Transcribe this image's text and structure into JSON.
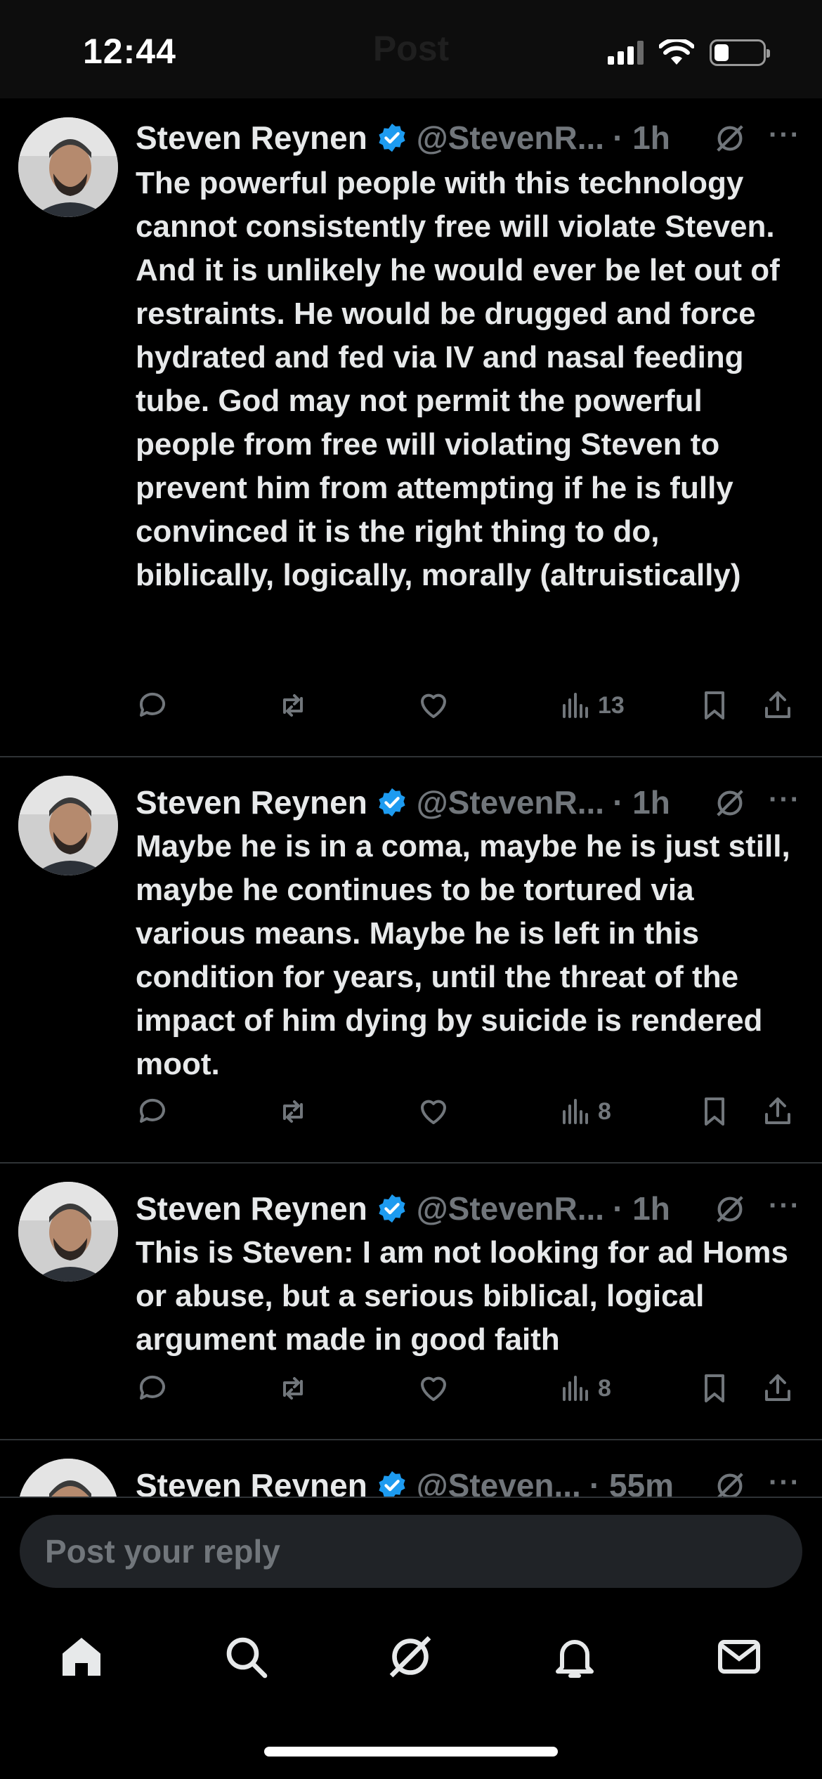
{
  "status_bar": {
    "time": "12:44",
    "battery_level": 0.3
  },
  "header": {
    "title": "Post"
  },
  "posts": [
    {
      "author": "Steven Reynen",
      "handle": "@StevenR...",
      "time": "· 1h",
      "text": "The powerful people with this technology cannot consistently free will violate Steven. And it is unlikely he would ever be let out of restraints. He would be drugged and force hydrated and fed via IV and nasal feeding tube. God may not permit the powerful people from free will violating Steven to prevent him from attempting if he is fully convinced it is the right thing to do, biblically, logically, morally (altruistically)",
      "views": "13"
    },
    {
      "author": "Steven Reynen",
      "handle": "@StevenR...",
      "time": "· 1h",
      "text": "Maybe he is in a coma, maybe he is just still, maybe he continues to be tortured via various means. Maybe he is left in this condition for years, until the threat of the impact of him dying by suicide is rendered moot.",
      "views": "8"
    },
    {
      "author": "Steven Reynen",
      "handle": "@StevenR...",
      "time": "· 1h",
      "text": "This is Steven: I am not looking for ad Homs or abuse, but a serious biblical, logical argument made in good faith",
      "views": "8"
    },
    {
      "author": "Steven Reynen",
      "handle": "@Steven...",
      "time": "· 55m",
      "text": "",
      "views": ""
    }
  ],
  "reply": {
    "placeholder": "Post your reply"
  },
  "icons": {
    "verified": "verified-badge-icon",
    "grok": "grok-icon",
    "more": "more-icon",
    "reply": "reply-icon",
    "repost": "repost-icon",
    "like": "like-icon",
    "views": "views-icon",
    "bookmark": "bookmark-icon",
    "share": "share-icon"
  },
  "colors": {
    "background": "#000000",
    "text": "#e7e9ea",
    "muted": "#71767b",
    "verified": "#1d9bf0",
    "divider": "#2f3336"
  }
}
